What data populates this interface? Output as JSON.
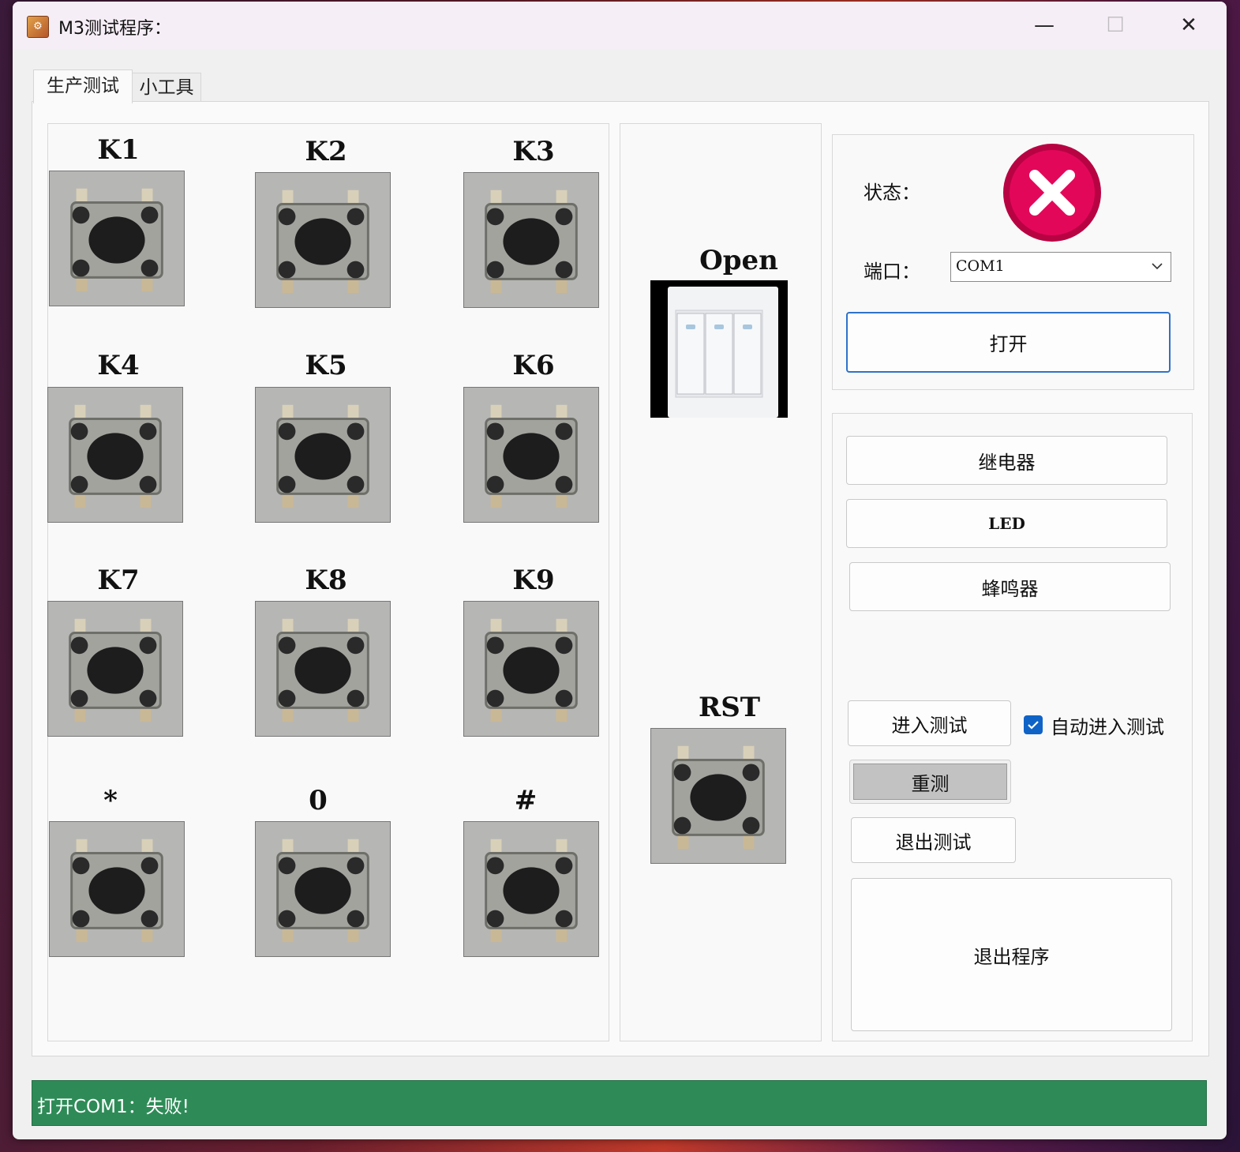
{
  "window": {
    "title": "M3测试程序：",
    "icon": "app-icon",
    "controls": [
      "minimize-icon",
      "maximize-icon",
      "close-icon"
    ]
  },
  "tabs": [
    {
      "label": "生产测试",
      "active": true
    },
    {
      "label": "小工具",
      "active": false
    }
  ],
  "keypad": {
    "keys": [
      "K1",
      "K2",
      "K3",
      "K4",
      "K5",
      "K6",
      "K7",
      "K8",
      "K9",
      "*",
      "0",
      "#"
    ]
  },
  "switches": {
    "open_label": "Open",
    "rst_label": "RST"
  },
  "connection": {
    "status_label": "状态：",
    "status_icon": "error-x-icon",
    "status_color": "#d4054f",
    "port_label": "端口：",
    "port_value": "COM1",
    "open_button": "打开"
  },
  "actions": {
    "relay": "继电器",
    "led": "LED",
    "buzzer": "蜂鸣器",
    "enter_test": "进入测试",
    "auto_enter_label": "自动进入测试",
    "auto_enter_checked": true,
    "retest": "重测",
    "exit_test": "退出测试",
    "exit_program": "退出程序"
  },
  "statusbar": {
    "message": "打开COM1：失败!",
    "color": "#2e8b57"
  },
  "colors": {
    "accent": "#2f72c9",
    "checkbox": "#0f63c7"
  }
}
